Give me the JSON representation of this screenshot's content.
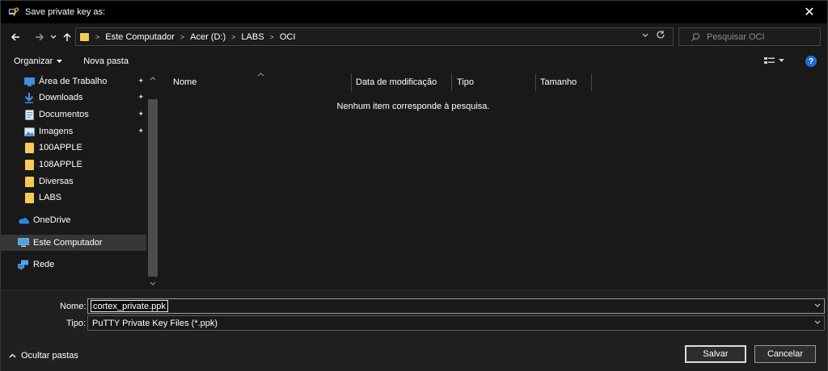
{
  "window": {
    "title": "Save private key as:",
    "close_glyph": "✕"
  },
  "addressbar": {
    "breadcrumbs": [
      "Este Computador",
      "Acer (D:)",
      "LABS",
      "OCI"
    ],
    "search_placeholder": "Pesquisar OCI"
  },
  "toolbar": {
    "organize_label": "Organizar",
    "new_folder_label": "Nova pasta"
  },
  "sidebar": {
    "items": [
      {
        "label": "Área de Trabalho",
        "icon": "desktop-icon",
        "pinned": true
      },
      {
        "label": "Downloads",
        "icon": "download-arrow-icon",
        "pinned": true
      },
      {
        "label": "Documentos",
        "icon": "document-icon",
        "pinned": true
      },
      {
        "label": "Imagens",
        "icon": "image-icon",
        "pinned": true
      },
      {
        "label": "100APPLE",
        "icon": "folder-icon",
        "pinned": false
      },
      {
        "label": "108APPLE",
        "icon": "folder-icon",
        "pinned": false
      },
      {
        "label": "Diversas",
        "icon": "folder-icon",
        "pinned": false
      },
      {
        "label": "LABS",
        "icon": "folder-icon",
        "pinned": false
      },
      {
        "label": "OneDrive",
        "icon": "cloud-icon",
        "pinned": false
      },
      {
        "label": "Este Computador",
        "icon": "computer-icon",
        "pinned": false,
        "selected": true
      },
      {
        "label": "Rede",
        "icon": "network-icon",
        "pinned": false
      }
    ]
  },
  "content": {
    "columns": [
      "Nome",
      "Data de modificação",
      "Tipo",
      "Tamanho"
    ],
    "empty_message": "Nenhum item corresponde à pesquisa."
  },
  "form": {
    "name_label": "Nome:",
    "name_value": "cortex_private.ppk",
    "type_label": "Tipo:",
    "type_value": "PuTTY Private Key Files (*.ppk)"
  },
  "footer": {
    "hide_folders_label": "Ocultar pastas",
    "save_label": "Salvar",
    "cancel_label": "Cancelar"
  },
  "colors": {
    "accent": "#1e6fd0",
    "folder": "#f6c95a",
    "background": "#191919"
  }
}
